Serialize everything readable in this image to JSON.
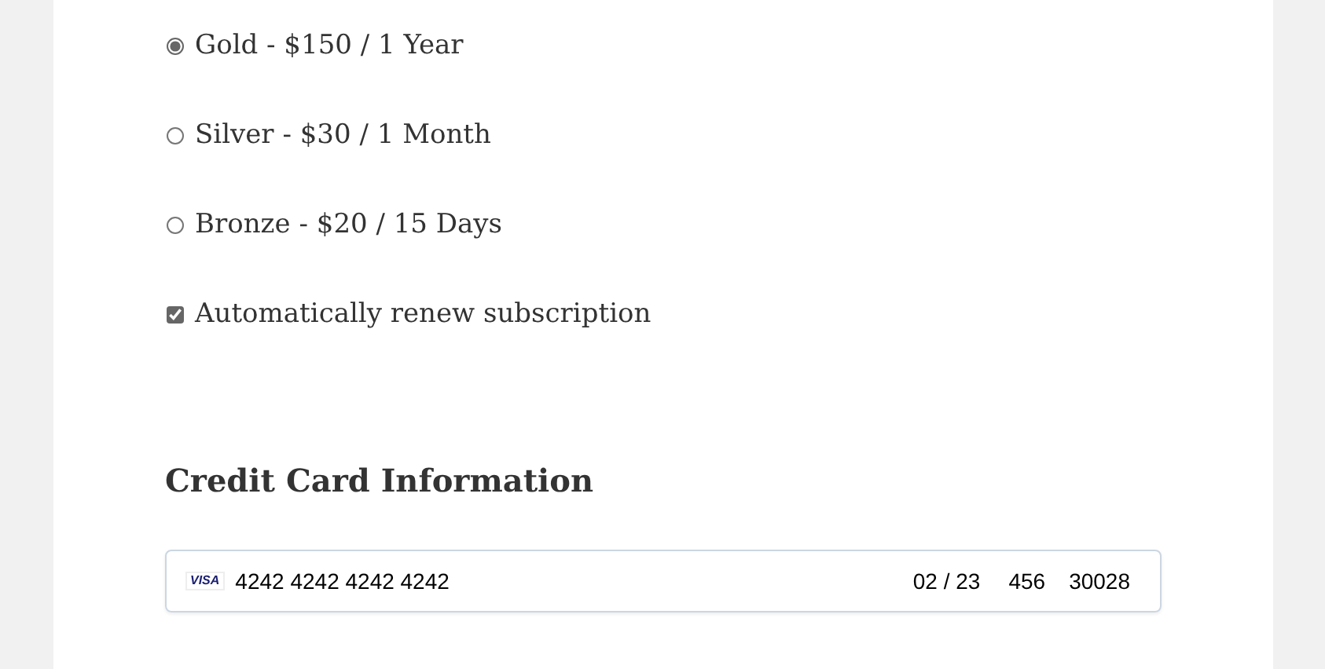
{
  "plans": [
    {
      "label": "Gold - $150 / 1 Year",
      "selected": true
    },
    {
      "label": "Silver - $30 / 1 Month",
      "selected": false
    },
    {
      "label": "Bronze - $20 / 15 Days",
      "selected": false
    }
  ],
  "auto_renew": {
    "label": "Automatically renew subscription",
    "checked": true
  },
  "card_section": {
    "heading": "Credit Card Information",
    "brand": "VISA",
    "number": "4242 4242 4242 4242",
    "expiry": "02 / 23",
    "cvc": "456",
    "zip": "30028"
  }
}
